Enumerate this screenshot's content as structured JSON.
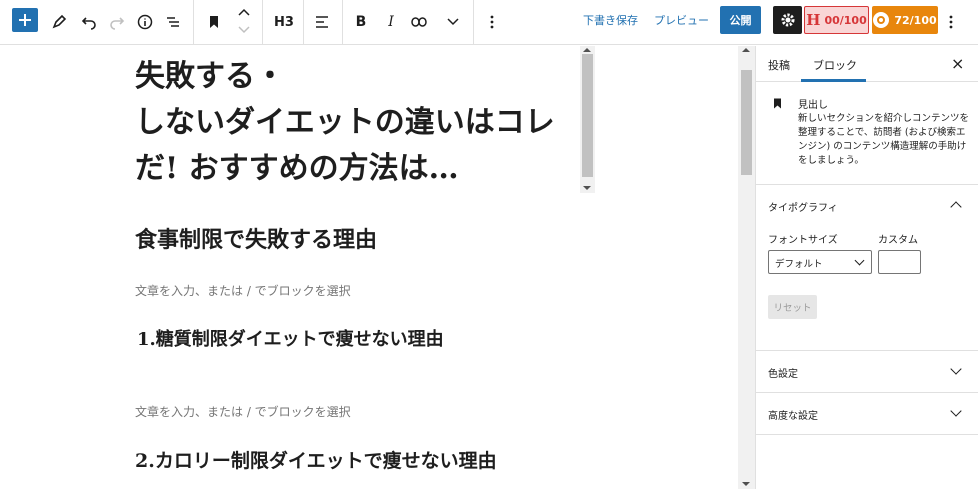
{
  "toolbar": {
    "block_style_label": "H3",
    "draft_save_label": "下書き保存",
    "preview_label": "プレビュー",
    "publish_label": "公開",
    "h_badge_letter": "H",
    "h_score": "00/100",
    "score_value": "72/100",
    "icons": [
      "plus-icon",
      "pen-icon",
      "undo-icon",
      "redo-icon",
      "info-icon",
      "list-view-icon",
      "bookmark-icon",
      "move-up-icon",
      "move-down-icon",
      "align-icon",
      "bold-icon",
      "italic-icon",
      "link-icon",
      "chevron-down-icon",
      "more-icon",
      "gear-icon"
    ],
    "bold_glyph": "B",
    "italic_glyph": "I"
  },
  "editor": {
    "post_title": "失敗する・しないダイエットの違いはコレだ! おすすめの方法は…",
    "title_lines": [
      "失敗する・",
      "しないダイエットの違いはコレ",
      "だ! おすすめの方法は…"
    ],
    "heading_h2": "食事制限で失敗する理由",
    "placeholder_1": "文章を入力、または / でブロックを選択",
    "heading_h3_1": "1.糖質制限ダイエットで痩せない理由",
    "placeholder_2": "文章を入力、または / でブロックを選択",
    "heading_h3_2": "2.カロリー制限ダイエットで痩せない理由"
  },
  "sidebar": {
    "tab_post": "投稿",
    "tab_block": "ブロック",
    "close_glyph": "×",
    "block_name": "見出し",
    "block_description": "新しいセクションを紹介しコンテンツを整理することで、訪問者 (および検索エンジン) のコンテンツ構造理解の手助けをしましょう。",
    "typography_title": "タイポグラフィ",
    "font_size_label": "フォントサイズ",
    "custom_label": "カスタム",
    "font_size_value": "デフォルト",
    "reset_label": "リセット",
    "color_settings_title": "色設定",
    "advanced_title": "高度な設定"
  },
  "colors": {
    "accent": "#2271b1",
    "h_badge_bg": "#f9d6d6",
    "h_badge_fg": "#d63638",
    "score_badge_bg": "#e8860c"
  }
}
